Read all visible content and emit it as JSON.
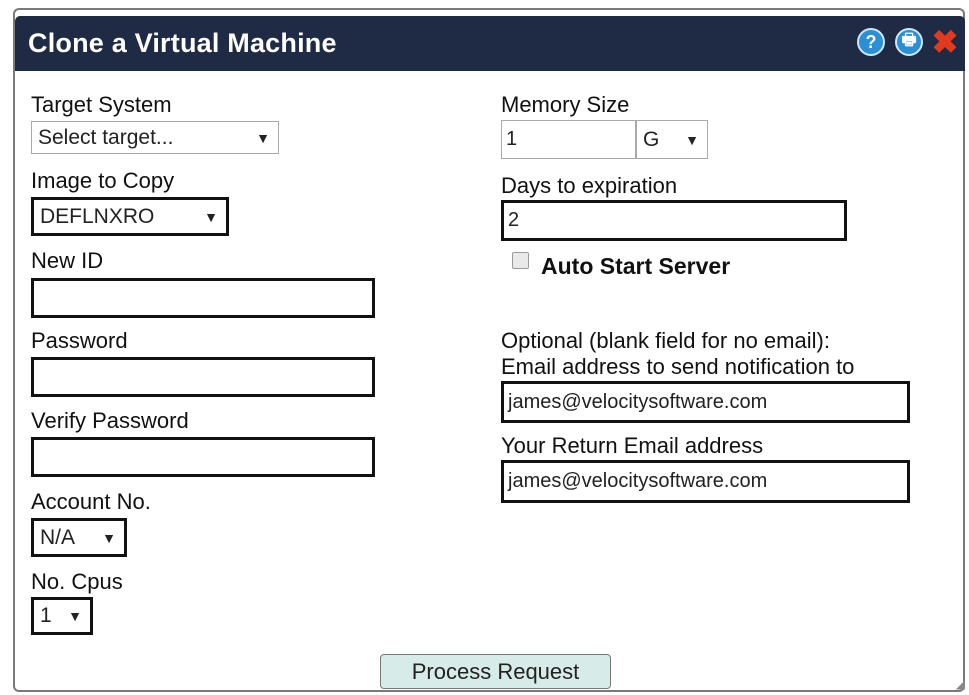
{
  "dialog": {
    "title": "Clone a Virtual Machine",
    "icons": {
      "help": "?",
      "print": "🖶",
      "close": "✖"
    }
  },
  "left": {
    "target_system_label": "Target System",
    "target_system_value": "Select target...",
    "image_label": "Image to Copy",
    "image_value": "DEFLNXRO",
    "new_id_label": "New ID",
    "new_id_value": "",
    "password_label": "Password",
    "password_value": "",
    "verify_password_label": "Verify Password",
    "verify_password_value": "",
    "account_label": "Account No.",
    "account_value": "N/A",
    "cpus_label": "No. Cpus",
    "cpus_value": "1"
  },
  "right": {
    "memory_label": "Memory Size",
    "memory_value": "1",
    "memory_unit": "G",
    "days_label": "Days to expiration",
    "days_value": "2",
    "auto_start_label": "Auto Start Server",
    "auto_start_checked": false,
    "optional_line1": "Optional (blank field for no email):",
    "optional_line2": "Email address to send notification to",
    "notify_email": "james@velocitysoftware.com",
    "return_label": "Your Return Email address",
    "return_email": "james@velocitysoftware.com"
  },
  "footer": {
    "process_label": "Process Request"
  },
  "arrow_glyph": "▼"
}
